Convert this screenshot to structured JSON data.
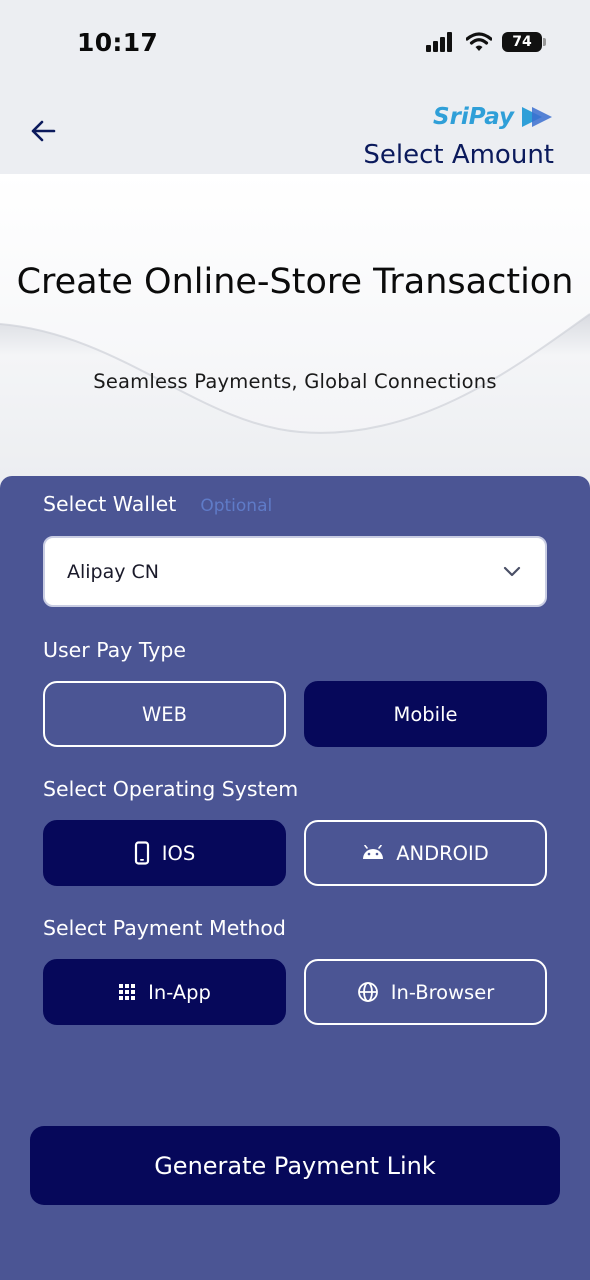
{
  "status_bar": {
    "time": "10:17",
    "battery": "74",
    "icons": [
      "signal-icon",
      "wifi-icon",
      "battery-icon"
    ]
  },
  "header": {
    "brand": "SriPay",
    "title": "Select Amount",
    "back_icon": "arrow-left-icon"
  },
  "hero": {
    "title": "Create Online-Store Transaction",
    "subtitle": "Seamless Payments, Global Connections"
  },
  "form": {
    "wallet": {
      "label": "Select Wallet",
      "optional": "Optional",
      "value": "Alipay CN"
    },
    "pay_type": {
      "label": "User Pay Type",
      "options": [
        "WEB",
        "Mobile"
      ],
      "selected": "Mobile"
    },
    "os": {
      "label": "Select Operating System",
      "options": [
        "IOS",
        "ANDROID"
      ],
      "selected": "IOS"
    },
    "payment_method": {
      "label": "Select Payment Method",
      "options": [
        "In-App",
        "In-Browser"
      ],
      "selected": "In-App"
    }
  },
  "footer": {
    "generate_label": "Generate Payment Link"
  },
  "colors": {
    "panel": "#4b5594",
    "selected": "#06085a",
    "brand": "#2f9fd8",
    "title": "#0b1a5c"
  }
}
